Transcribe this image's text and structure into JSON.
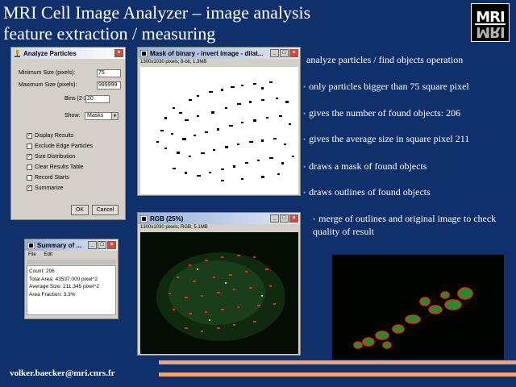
{
  "slide": {
    "title_line1": "MRI Cell Image Analyzer – image analysis",
    "title_line2": "feature extraction / measuring",
    "logo_text": "MRI",
    "footer_email": "volker.baecker@mri.cnrs.fr"
  },
  "analyze_particles": {
    "title": "Analyze Particles",
    "min_label": "Minimum Size (pixels):",
    "min_value": "75",
    "max_label": "Maximum Size (pixels):",
    "max_value": "999999",
    "bins_label": "Bins (2-256):",
    "bins_value": "20",
    "show_label": "Show:",
    "show_value": "Masks",
    "checkboxes": [
      {
        "label": "Display Results",
        "checked": true
      },
      {
        "label": "Exclude Edge Particles",
        "checked": false
      },
      {
        "label": "Size Distribution",
        "checked": true
      },
      {
        "label": "Clear Results Table",
        "checked": false
      },
      {
        "label": "Record Starts",
        "checked": false
      },
      {
        "label": "Summarize",
        "checked": true
      }
    ],
    "ok_label": "OK",
    "cancel_label": "Cancel"
  },
  "mask_window": {
    "title": "Mask of binary - invert image - dilat...",
    "info": "1300x1030 pixels; 8-bit; 1.3MB"
  },
  "rgb_window": {
    "title": "RGB (25%)",
    "info": "1300x1030 pixels; RGB; 5.1MB"
  },
  "summary_window": {
    "title": "Summary of ...",
    "menu": [
      "File",
      "Edit"
    ],
    "lines": [
      "Count: 206",
      "Total Area: 43537.000 pixel^2",
      "Average Size: 211.345 pixel^2",
      "Area Fraction: 3.3%"
    ]
  },
  "bullets": [
    "analyze particles / find objects operation",
    "only particles bigger than 75 square pixel",
    "gives the number of found objects: 206",
    "gives the average size in square pixel 211",
    "draws a mask of found objects",
    "draws outlines of found objects",
    "merge of outlines and original image to check quality of result"
  ],
  "icons": {
    "dialog_icon": "microscope-icon",
    "window_icon": "imagej-icon"
  },
  "colors": {
    "background": "#10306b",
    "accent_bar": "#f4a36a",
    "outline_red": "#e03020",
    "cell_green": "#3a9a3a"
  }
}
